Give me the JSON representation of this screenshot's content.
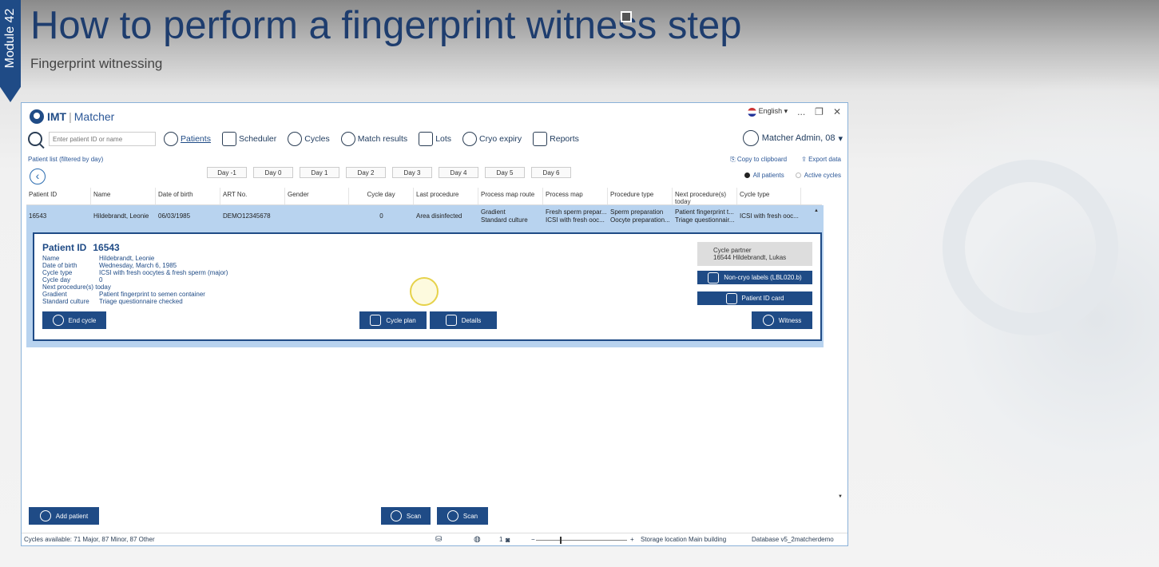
{
  "slide": {
    "module": "Module 42",
    "title": "How to perform a fingerprint witness step",
    "subtitle": "Fingerprint witnessing"
  },
  "app": {
    "logo_brand": "IMT",
    "logo_separator": "|",
    "logo_product": "Matcher",
    "language": "English",
    "window_controls": [
      "...",
      "❐",
      "✕"
    ],
    "user": "Matcher Admin, 08"
  },
  "nav": {
    "search_placeholder": "Enter patient ID or name",
    "items": [
      {
        "label": "Patients",
        "icon": "patients-icon"
      },
      {
        "label": "Scheduler",
        "icon": "calendar-icon"
      },
      {
        "label": "Cycles",
        "icon": "cycles-icon"
      },
      {
        "label": "Match results",
        "icon": "match-results-icon"
      },
      {
        "label": "Lots",
        "icon": "lots-icon"
      },
      {
        "label": "Cryo expiry",
        "icon": "cryo-expiry-icon"
      },
      {
        "label": "Reports",
        "icon": "reports-icon"
      }
    ]
  },
  "list": {
    "label": "Patient list (filtered by day)",
    "copy": "Copy to clipboard",
    "export": "Export data",
    "days": [
      "Day -1",
      "Day 0",
      "Day 1",
      "Day 2",
      "Day 3",
      "Day 4",
      "Day 5",
      "Day 6"
    ],
    "radio_all": "All patients",
    "radio_active": "Active cycles",
    "columns": [
      "Patient ID",
      "Name",
      "Date of birth",
      "ART No.",
      "Gender",
      "Cycle day",
      "Last procedure",
      "Process map route",
      "Process map",
      "Procedure type",
      "Next procedure(s) today",
      "Cycle type"
    ],
    "row": {
      "patient_id": "16543",
      "name": "Hildebrandt, Leonie",
      "dob": "06/03/1985",
      "art": "DEMO12345678",
      "gender": "",
      "cycle_day": "0",
      "last_procedure": "Area disinfected",
      "route_1": "Gradient",
      "route_2": "Standard culture",
      "map_1": "Fresh sperm prepar...",
      "map_2": "ICSI with fresh ooc...",
      "ptype_1": "Sperm preparation",
      "ptype_2": "Oocyte preparation...",
      "next_1": "Patient fingerprint t...",
      "next_2": "Triage questionnair...",
      "cycle_type": "ICSI with fresh ooc..."
    }
  },
  "detail": {
    "pid_label": "Patient ID",
    "pid_value": "16543",
    "fields": [
      {
        "k": "Name",
        "v": "Hildebrandt, Leonie"
      },
      {
        "k": "Date of birth",
        "v": "Wednesday, March 6, 1985"
      },
      {
        "k": "Cycle type",
        "v": "ICSI with fresh oocytes & fresh sperm (major)"
      },
      {
        "k": "Cycle day",
        "v": "0"
      },
      {
        "k": "Next procedure(s) today",
        "v": ""
      },
      {
        "k": "Gradient",
        "v": "Patient fingerprint to semen container"
      },
      {
        "k": "Standard culture",
        "v": "Triage questionnaire checked"
      }
    ],
    "partner_label": "Cycle partner",
    "partner_value": "16544   Hildebrandt, Lukas",
    "btn_noncryo": "Non-cryo labels (LBL020.b)",
    "btn_idcard": "Patient ID card",
    "btn_witness": "Witness",
    "btn_end": "End cycle",
    "btn_plan": "Cycle plan",
    "btn_details": "Details"
  },
  "bottom": {
    "add_patient": "Add patient",
    "scan1": "Scan",
    "scan2": "Scan"
  },
  "status": {
    "cycles": "Cycles available: 71 Major, 87 Minor, 87 Other",
    "count": "1",
    "storage": "Storage location  Main building",
    "database": "Database  v5_2matcherdemo"
  }
}
